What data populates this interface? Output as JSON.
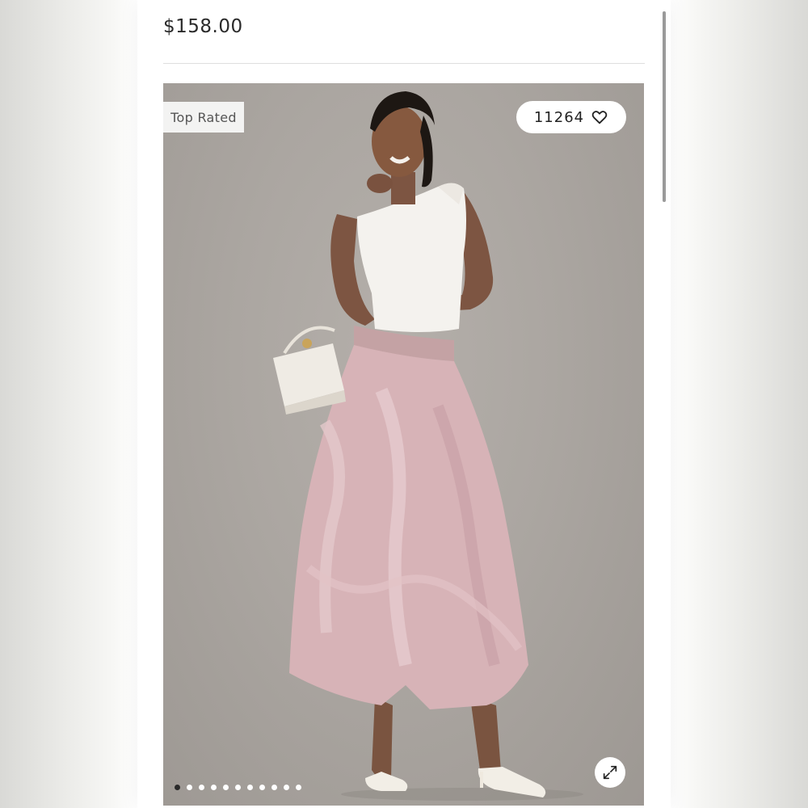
{
  "product": {
    "price": "$158.00"
  },
  "gallery": {
    "badge_label": "Top Rated",
    "favorite_count": "11264",
    "icons": {
      "favorite": "heart-outline-icon",
      "expand": "expand-arrows-icon"
    },
    "slides_total": 11,
    "slide_active": 1
  },
  "colors": {
    "background": "#aba6a1",
    "skirt": "#d7b3b7",
    "top": "#f4f2ee",
    "text": "#2a2a2a"
  }
}
